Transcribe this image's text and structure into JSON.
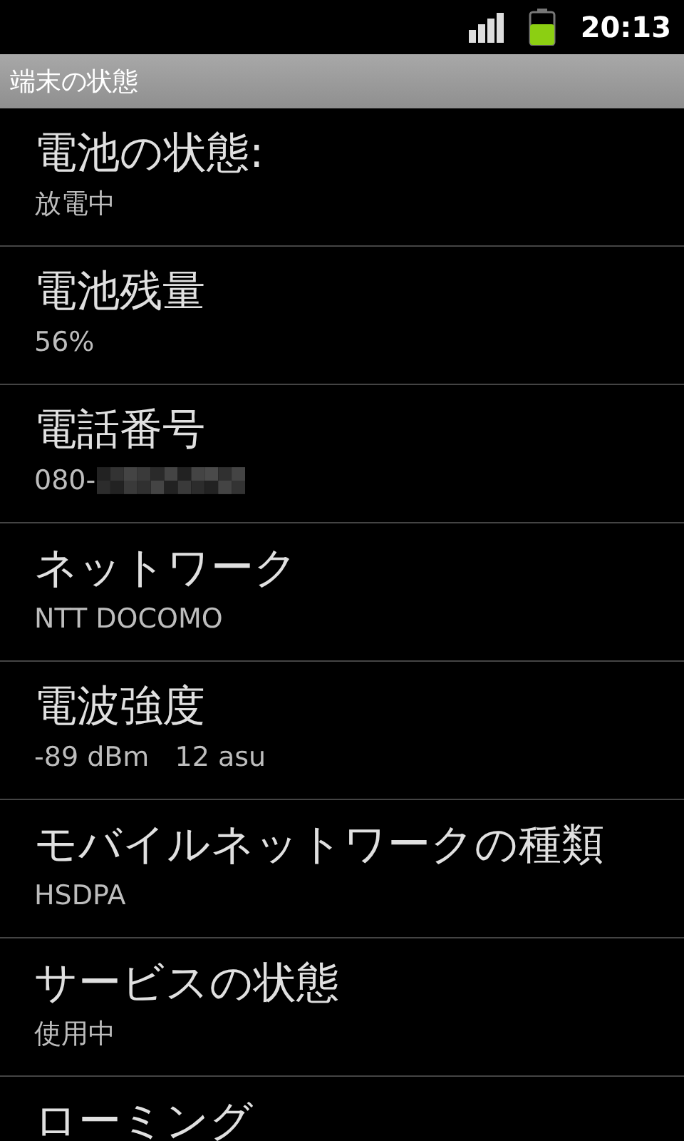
{
  "status_bar": {
    "time": "20:13"
  },
  "header": {
    "title": "端末の状態"
  },
  "items": [
    {
      "title": "電池の状態:",
      "summary": "放電中"
    },
    {
      "title": "電池残量",
      "summary": "56%"
    },
    {
      "title": "電話番号",
      "summary": "080-",
      "redacted": true
    },
    {
      "title": "ネットワーク",
      "summary": "NTT DOCOMO"
    },
    {
      "title": "電波強度",
      "summary": "-89 dBm   12 asu"
    },
    {
      "title": "モバイルネットワークの種類",
      "summary": "HSDPA"
    },
    {
      "title": "サービスの状態",
      "summary": "使用中"
    },
    {
      "title": "ローミング"
    }
  ]
}
